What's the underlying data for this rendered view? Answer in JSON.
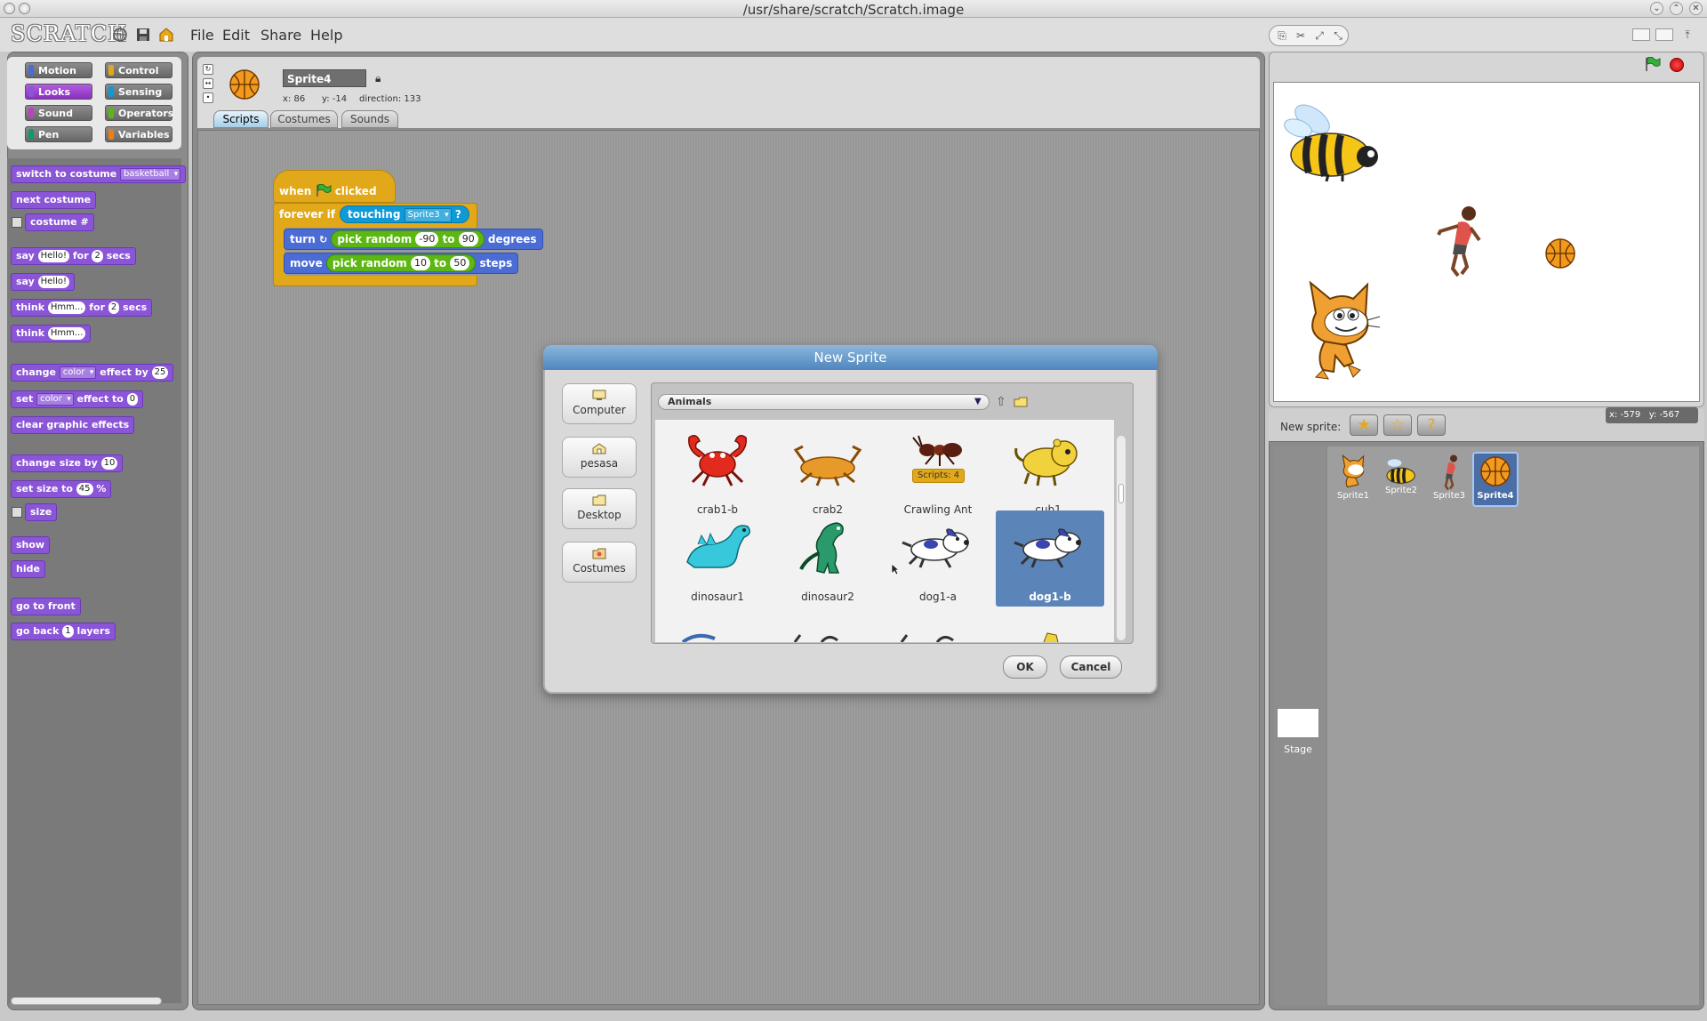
{
  "window": {
    "title": "/usr/share/scratch/Scratch.image"
  },
  "app": {
    "logo": "SCRATCH",
    "menus": [
      "File",
      "Edit",
      "Share",
      "Help"
    ]
  },
  "palette": {
    "categories": [
      {
        "label": "Motion",
        "color": "#4a6cd4"
      },
      {
        "label": "Control",
        "color": "#e1a91a"
      },
      {
        "label": "Looks",
        "color": "#8a55d7"
      },
      {
        "label": "Sensing",
        "color": "#0e9ad6"
      },
      {
        "label": "Sound",
        "color": "#bb42c3"
      },
      {
        "label": "Operators",
        "color": "#5cb712"
      },
      {
        "label": "Pen",
        "color": "#0e9a6c"
      },
      {
        "label": "Variables",
        "color": "#ee7d16"
      }
    ],
    "selected_category": "Looks",
    "blocks": {
      "switch_costume": "switch to costume",
      "switch_costume_value": "basketball",
      "next_costume": "next costume",
      "costume_num": "costume #",
      "say_for": "say",
      "say_for_text": "Hello!",
      "say_for_for": "for",
      "say_for_secs_val": "2",
      "say_for_secs": "secs",
      "say": "say",
      "say_text": "Hello!",
      "think_for": "think",
      "think_for_text": "Hmm...",
      "think_for_for": "for",
      "think_for_secs_val": "2",
      "think_for_secs": "secs",
      "think": "think",
      "think_text": "Hmm...",
      "change_effect": "change",
      "change_effect_drop": "color",
      "change_effect_by": "effect by",
      "change_effect_val": "25",
      "set_effect": "set",
      "set_effect_drop": "color",
      "set_effect_to": "effect to",
      "set_effect_val": "0",
      "clear_effects": "clear graphic effects",
      "change_size": "change size by",
      "change_size_val": "10",
      "set_size": "set size to",
      "set_size_val": "45",
      "set_size_unit": "%",
      "size": "size",
      "show": "show",
      "hide": "hide",
      "go_front": "go to front",
      "go_back": "go back",
      "go_back_val": "1",
      "go_back_unit": "layers"
    }
  },
  "sprite_header": {
    "name": "Sprite4",
    "x_label": "x:",
    "x": "86",
    "y_label": "y:",
    "y": "-14",
    "direction_label": "direction:",
    "direction": "133",
    "tabs": [
      "Scripts",
      "Costumes",
      "Sounds"
    ],
    "active_tab": "Scripts"
  },
  "script": {
    "hat_when": "when",
    "hat_clicked": "clicked",
    "forever_if": "forever if",
    "touching": "touching",
    "touching_target": "Sprite3",
    "touching_q": "?",
    "turn": "turn",
    "pick_random_1": "pick random",
    "turn_min": "-90",
    "to_1": "to",
    "turn_max": "90",
    "degrees": "degrees",
    "move": "move",
    "pick_random_2": "pick random",
    "move_min": "10",
    "to_2": "to",
    "move_max": "50",
    "steps": "steps"
  },
  "stage": {
    "mouse_x_label": "x:",
    "mouse_x": "-579",
    "mouse_y_label": "y:",
    "mouse_y": "-567",
    "new_sprite_label": "New sprite:"
  },
  "sprites": [
    {
      "name": "Sprite1",
      "icon": "cat"
    },
    {
      "name": "Sprite2",
      "icon": "bee"
    },
    {
      "name": "Sprite3",
      "icon": "girl"
    },
    {
      "name": "Sprite4",
      "icon": "basketball",
      "selected": true
    }
  ],
  "stage_label": "Stage",
  "dialog": {
    "title": "New Sprite",
    "places": [
      "Computer",
      "pesasa",
      "Desktop",
      "Costumes"
    ],
    "folder": "Animals",
    "items": [
      {
        "label": "crab1-b",
        "icon": "crab-red"
      },
      {
        "label": "crab2",
        "icon": "crab-orange"
      },
      {
        "label": "Crawling Ant",
        "icon": "ant",
        "badge": "Scripts: 4"
      },
      {
        "label": "cub1",
        "icon": "cub"
      },
      {
        "label": "dinosaur1",
        "icon": "dino-cyan"
      },
      {
        "label": "dinosaur2",
        "icon": "dino-green"
      },
      {
        "label": "dog1-a",
        "icon": "dog"
      },
      {
        "label": "dog1-b",
        "icon": "dog",
        "selected": true
      }
    ],
    "ok": "OK",
    "cancel": "Cancel"
  },
  "colors": {
    "looks": "#8a55d7",
    "control": "#e1a91a",
    "sensing": "#0e9ad6",
    "operators": "#5cb712",
    "motion": "#4a6cd4",
    "selection": "#5b84b8"
  }
}
